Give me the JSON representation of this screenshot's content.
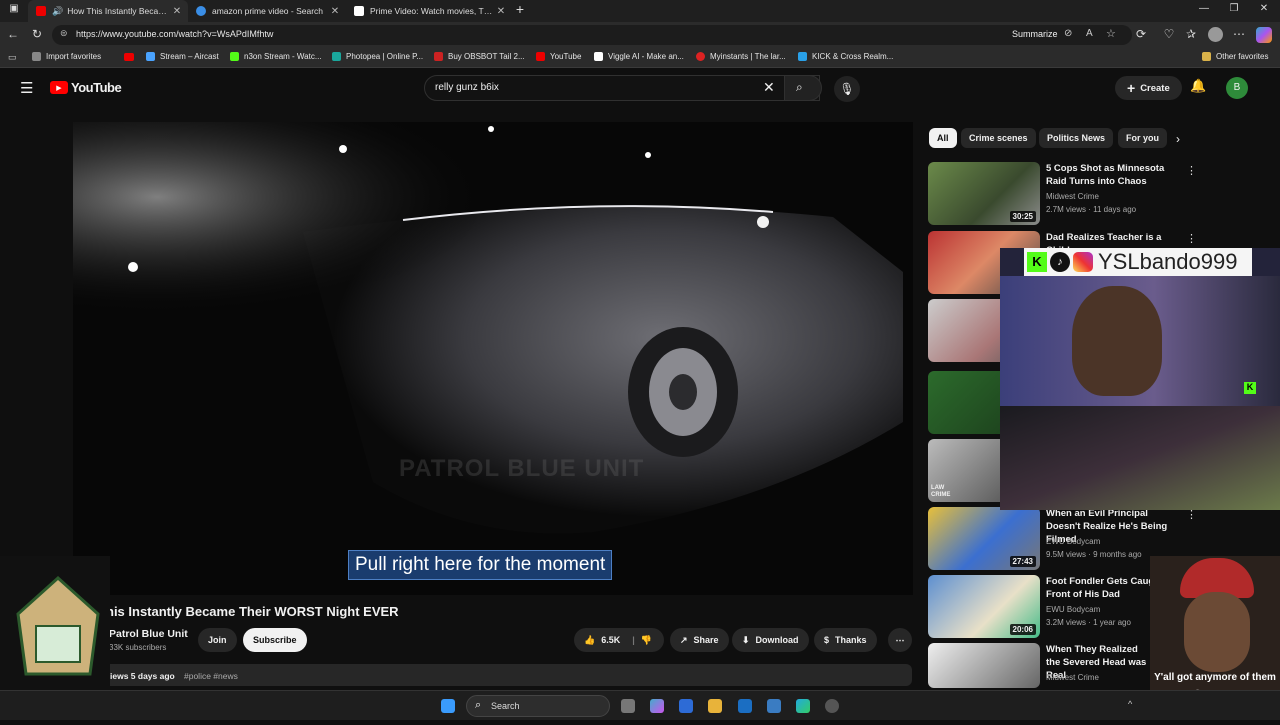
{
  "browser": {
    "tabs": [
      {
        "title": "How This Instantly Became T",
        "active": true
      },
      {
        "title": "amazon prime video - Search",
        "active": false
      },
      {
        "title": "Prime Video: Watch movies, TV sh",
        "active": false
      }
    ],
    "url": "https://www.youtube.com/watch?v=WsAPdIMfhtw",
    "summarize_label": "Summarize",
    "bookmarks": [
      "Import favorites",
      "Stream – Aircast",
      "n3on Stream - Watc...",
      "Photopea | Online P...",
      "Buy OBSBOT Tail 2...",
      "YouTube",
      "Viggle AI - Make an...",
      "Myinstants | The lar...",
      "KICK & Cross Realm..."
    ],
    "other_favorites": "Other favorites"
  },
  "youtube": {
    "logo_text": "YouTube",
    "search_value": "relly gunz b6ix",
    "create_label": "Create",
    "avatar_letter": "B",
    "chips": [
      "All",
      "Crime scenes",
      "Politics News",
      "For you"
    ],
    "video": {
      "watermark": "PATROL BLUE UNIT",
      "caption": "Pull right here for the moment",
      "title": "his Instantly Became Their WORST Night EVER",
      "channel": "Patrol Blue Unit",
      "subscribers": "33K subscribers",
      "join": "Join",
      "subscribe": "Subscribe",
      "likes": "6.5K",
      "share": "Share",
      "download": "Download",
      "thanks": "Thanks",
      "views_date": "iews  5 days ago",
      "hashtags": "#police #news"
    },
    "recommendations": [
      {
        "title": "5 Cops Shot as Minnesota Raid Turns into Chaos",
        "channel": "Midwest Crime",
        "meta": "2.7M views · 11 days ago",
        "duration": "30:25"
      },
      {
        "title": "Dad Realizes Teacher is a Child",
        "channel": "",
        "meta": "",
        "duration": ""
      },
      {
        "title": "When an Evil Principal Doesn't Realize He's Being Filmed",
        "channel": "EWU Bodycam",
        "meta": "9.5M views · 9 months ago",
        "duration": "27:43"
      },
      {
        "title": "Foot Fondler Gets Caught in Front of His Dad",
        "channel": "EWU Bodycam",
        "meta": "3.2M views · 1 year ago",
        "duration": "20:06"
      },
      {
        "title": "When They Realized the Severed Head was Real",
        "channel": "Midwest Crime",
        "meta": "",
        "duration": ""
      }
    ]
  },
  "overlays": {
    "streamer_name": "YSLbando999",
    "bottom_text_1": "Y'all got anymore of them",
    "bottom_text_2": "KICK's!!!",
    "law_label": "LAW CRIME"
  },
  "taskbar": {
    "search_placeholder": "Search"
  }
}
